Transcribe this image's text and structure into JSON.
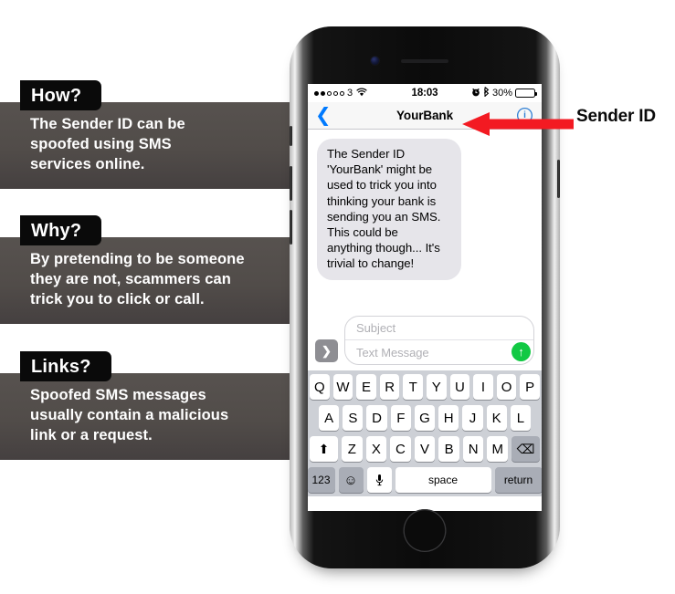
{
  "callouts": [
    {
      "id": "how",
      "tab_label": "How?",
      "body_text": "The Sender ID can be\nspoofed using SMS\nservices online."
    },
    {
      "id": "why",
      "tab_label": "Why?",
      "body_text": "By pretending to be someone\nthey are not, scammers can\ntrick you to click or call."
    },
    {
      "id": "links",
      "tab_label": "Links?",
      "body_text": "Spoofed SMS messages\nusually contain a malicious\nlink or a request."
    }
  ],
  "annotation": {
    "label": "Sender ID",
    "arrow_color": "#f31a22",
    "arrow_direction": "left",
    "arrow_icon": "left-arrow-icon"
  },
  "phone": {
    "status_bar": {
      "signal_dots_filled": 2,
      "signal_dots_total": 5,
      "carrier": "3",
      "wifi_icon": "wifi-icon",
      "time": "18:03",
      "alarm_icon": "alarm-clock-icon",
      "bluetooth_icon": "bluetooth-icon",
      "battery_percent": "30%",
      "battery_level": 30
    },
    "nav_bar": {
      "back_icon": "chevron-left-icon",
      "title": "YourBank",
      "info_icon": "contact-info-icon",
      "info_glyph": "i"
    },
    "conversation": {
      "messages": [
        {
          "sender": "YourBank",
          "incoming": true,
          "text": "The Sender ID\n'YourBank' might be\nused to trick you into\nthinking your bank is\nsending you an SMS.\nThis could be\nanything though... It's\ntrivial to change!"
        }
      ]
    },
    "compose": {
      "expand_button_glyph": "❯",
      "expand_button_name": "expand-apps-button",
      "subject_placeholder": "Subject",
      "subject_value": "",
      "message_placeholder": "Text Message",
      "message_value": "",
      "send_icon": "send-arrow-up-icon",
      "send_glyph": "↑",
      "send_color": "#12c944"
    },
    "keyboard": {
      "row1": [
        "Q",
        "W",
        "E",
        "R",
        "T",
        "Y",
        "U",
        "I",
        "O",
        "P"
      ],
      "row2": [
        "A",
        "S",
        "D",
        "F",
        "G",
        "H",
        "J",
        "K",
        "L"
      ],
      "row3_letters": [
        "Z",
        "X",
        "C",
        "V",
        "B",
        "N",
        "M"
      ],
      "shift_icon": "shift-arrow-up-icon",
      "shift_glyph": "⬆",
      "backspace_icon": "backspace-delete-icon",
      "backspace_glyph": "⌫",
      "numbers_key": "123",
      "emoji_icon": "emoji-smiley-icon",
      "emoji_glyph": "☺",
      "dictation_icon": "microphone-icon",
      "dictation_glyph": "ⱼ",
      "space_key": "space",
      "return_key": "return"
    },
    "hardware": {
      "earpiece": "earpiece-speaker",
      "front_camera": "front-camera",
      "home_button": "home-button",
      "silent_switch": "silent-switch",
      "volume_up": "volume-up-button",
      "volume_down": "volume-down-button",
      "power": "power-button"
    }
  }
}
